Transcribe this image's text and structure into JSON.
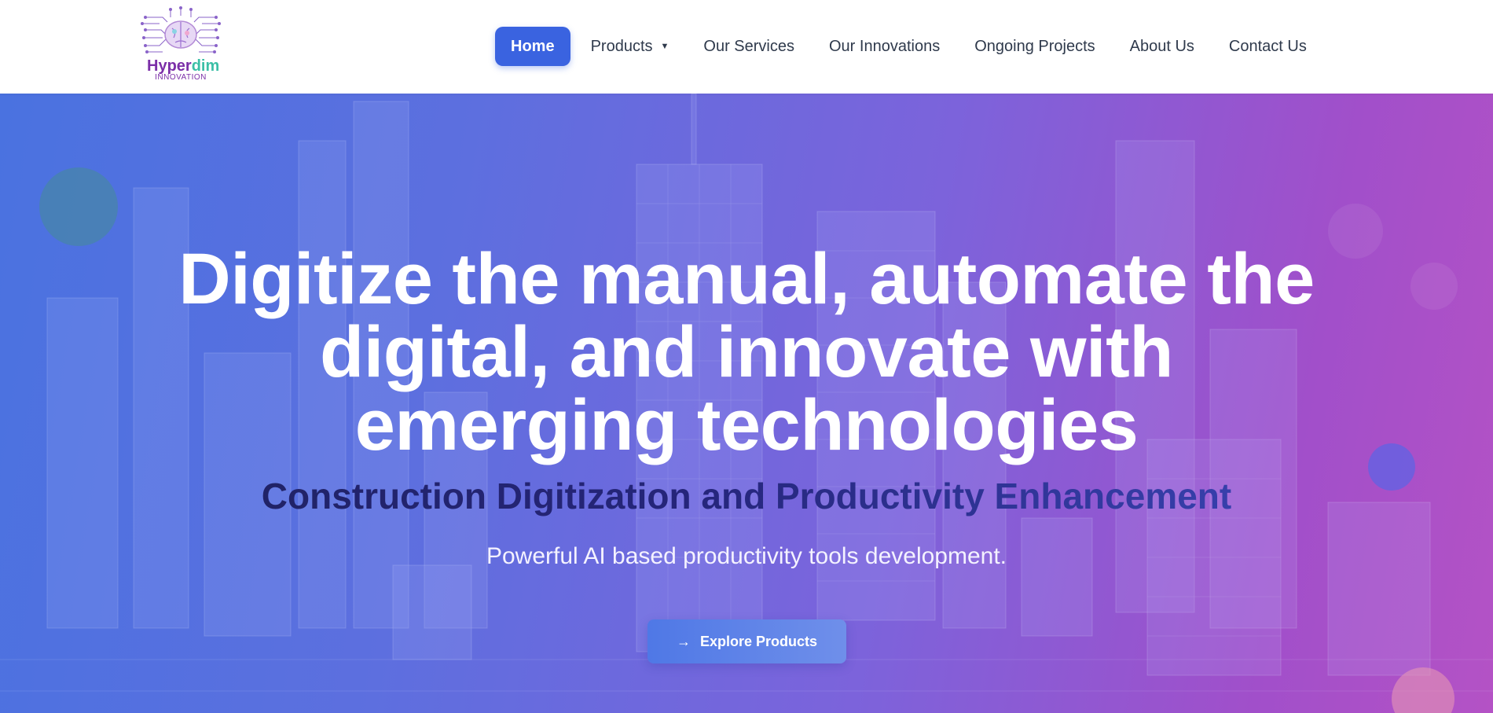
{
  "logo": {
    "name_part1": "Hyper",
    "name_part2": "dim",
    "subtitle": "INNOVATION",
    "icon": "brain-circuit-icon"
  },
  "nav": {
    "items": [
      {
        "label": "Home",
        "active": true
      },
      {
        "label": "Products",
        "has_dropdown": true
      },
      {
        "label": "Our Services"
      },
      {
        "label": "Our Innovations"
      },
      {
        "label": "Ongoing Projects"
      },
      {
        "label": "About Us"
      },
      {
        "label": "Contact Us"
      }
    ],
    "dropdown_icon": "caret-down-icon"
  },
  "hero": {
    "title_line1": "Digitize the manual, automate the",
    "title_line2": "digital, and innovate with",
    "title_line3": "emerging technologies",
    "subtitle": "Construction Digitization and Productivity Enhancement",
    "tagline": "Powerful AI based productivity tools development.",
    "cta_label": "Explore Products",
    "cta_icon": "arrow-right-icon",
    "background": "city-skyline-image"
  },
  "colors": {
    "accent": "#3a63e0",
    "gradient_start": "#4a72e0",
    "gradient_end": "#b452c5",
    "nav_text": "#2f3a4c"
  }
}
